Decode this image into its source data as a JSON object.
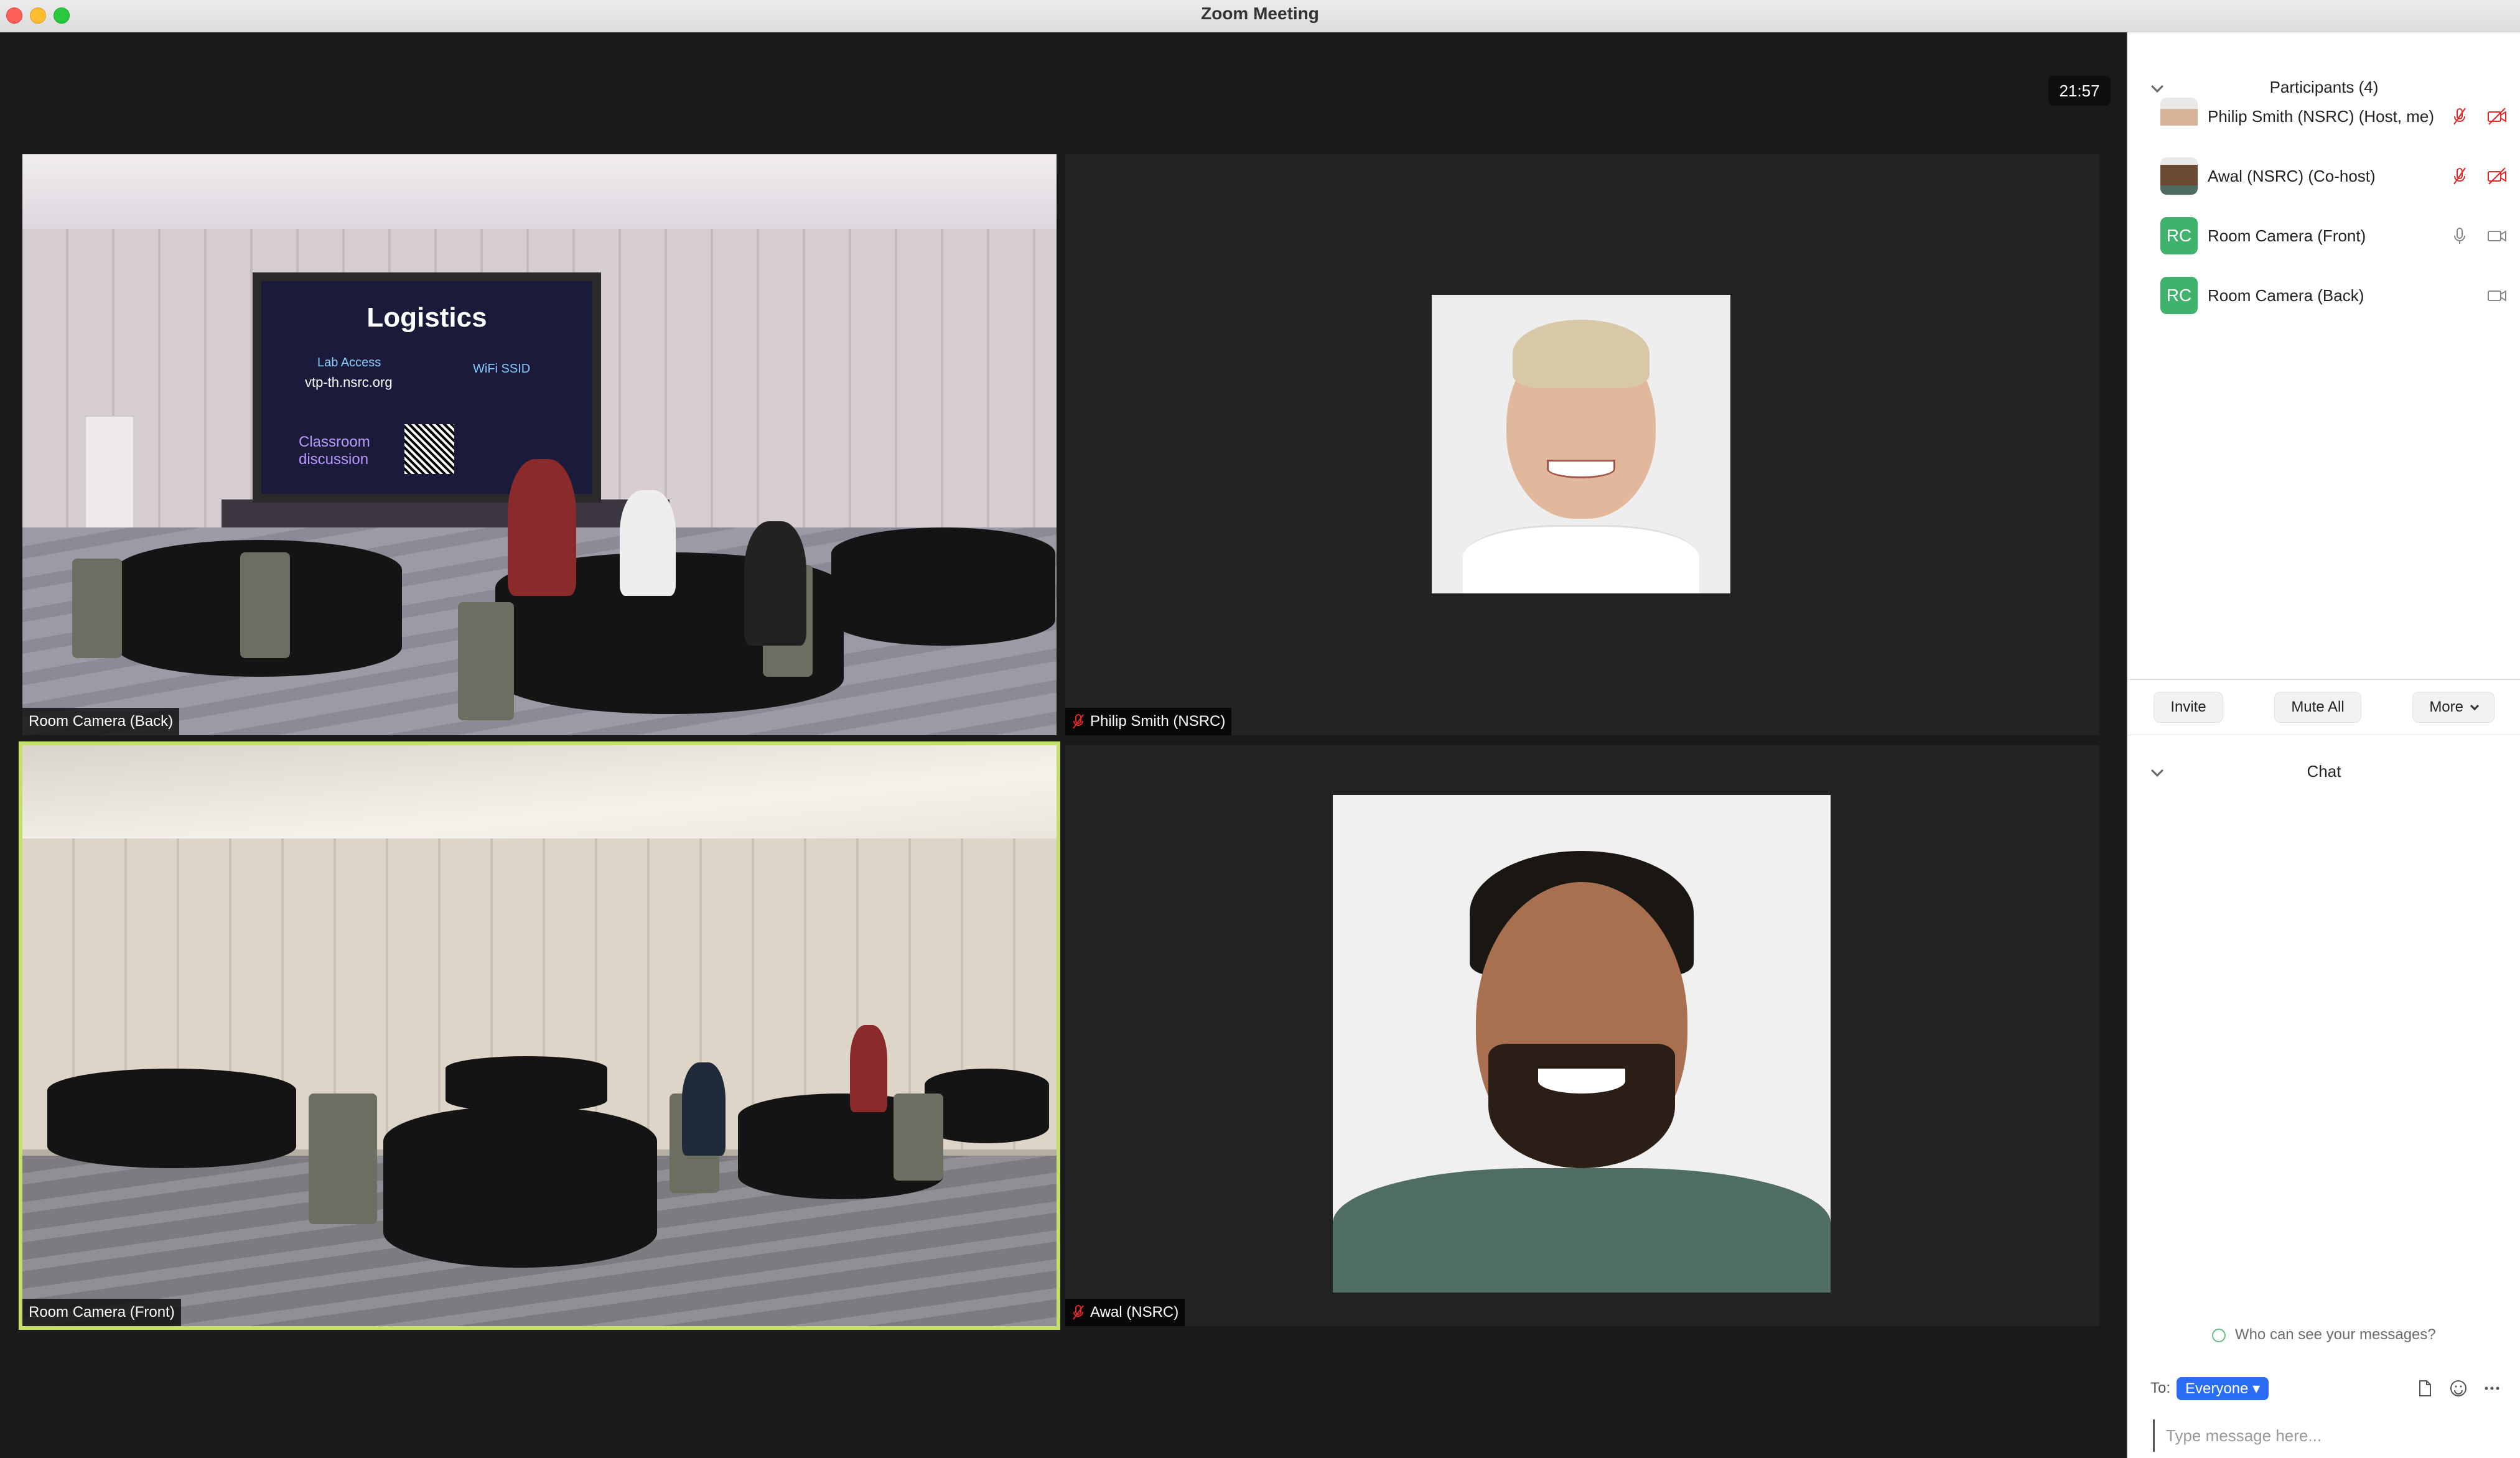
{
  "window": {
    "title": "Zoom Meeting"
  },
  "meeting": {
    "timer": "21:57",
    "tiles": [
      {
        "id": "room-back",
        "label": "Room Camera (Back)",
        "muted": false
      },
      {
        "id": "philip",
        "label": "Philip Smith (NSRC)",
        "muted": true
      },
      {
        "id": "room-front",
        "label": "Room Camera (Front)",
        "muted": false,
        "active": true
      },
      {
        "id": "awal",
        "label": "Awal (NSRC)",
        "muted": true
      }
    ],
    "slide": {
      "title": "Logistics",
      "lab_access": "Lab Access",
      "url": "vtp-th.nsrc.org",
      "wifi": "WiFi SSID",
      "classroom": "Classroom discussion"
    }
  },
  "participants": {
    "header": "Participants (4)",
    "items": [
      {
        "name": "Philip Smith (NSRC)  (Host, me)",
        "avatar": "photo",
        "mic": "muted",
        "video": "off"
      },
      {
        "name": "Awal (NSRC) (Co-host)",
        "avatar": "photo",
        "mic": "muted",
        "video": "off"
      },
      {
        "name": "Room Camera (Front)",
        "avatar": "RC",
        "mic": "on",
        "video": "on"
      },
      {
        "name": "Room Camera (Back)",
        "avatar": "RC",
        "mic": "none",
        "video": "on"
      }
    ],
    "buttons": {
      "invite": "Invite",
      "mute_all": "Mute All",
      "more": "More"
    }
  },
  "chat": {
    "header": "Chat",
    "who_can_see": "Who can see your messages?",
    "to_label": "To:",
    "to_value": "Everyone",
    "placeholder": "Type message here..."
  },
  "colors": {
    "active_speaker": "#c5e06a",
    "rc_avatar": "#3fb36b",
    "to_pill": "#2a6df4",
    "muted_icon": "#e02828"
  }
}
